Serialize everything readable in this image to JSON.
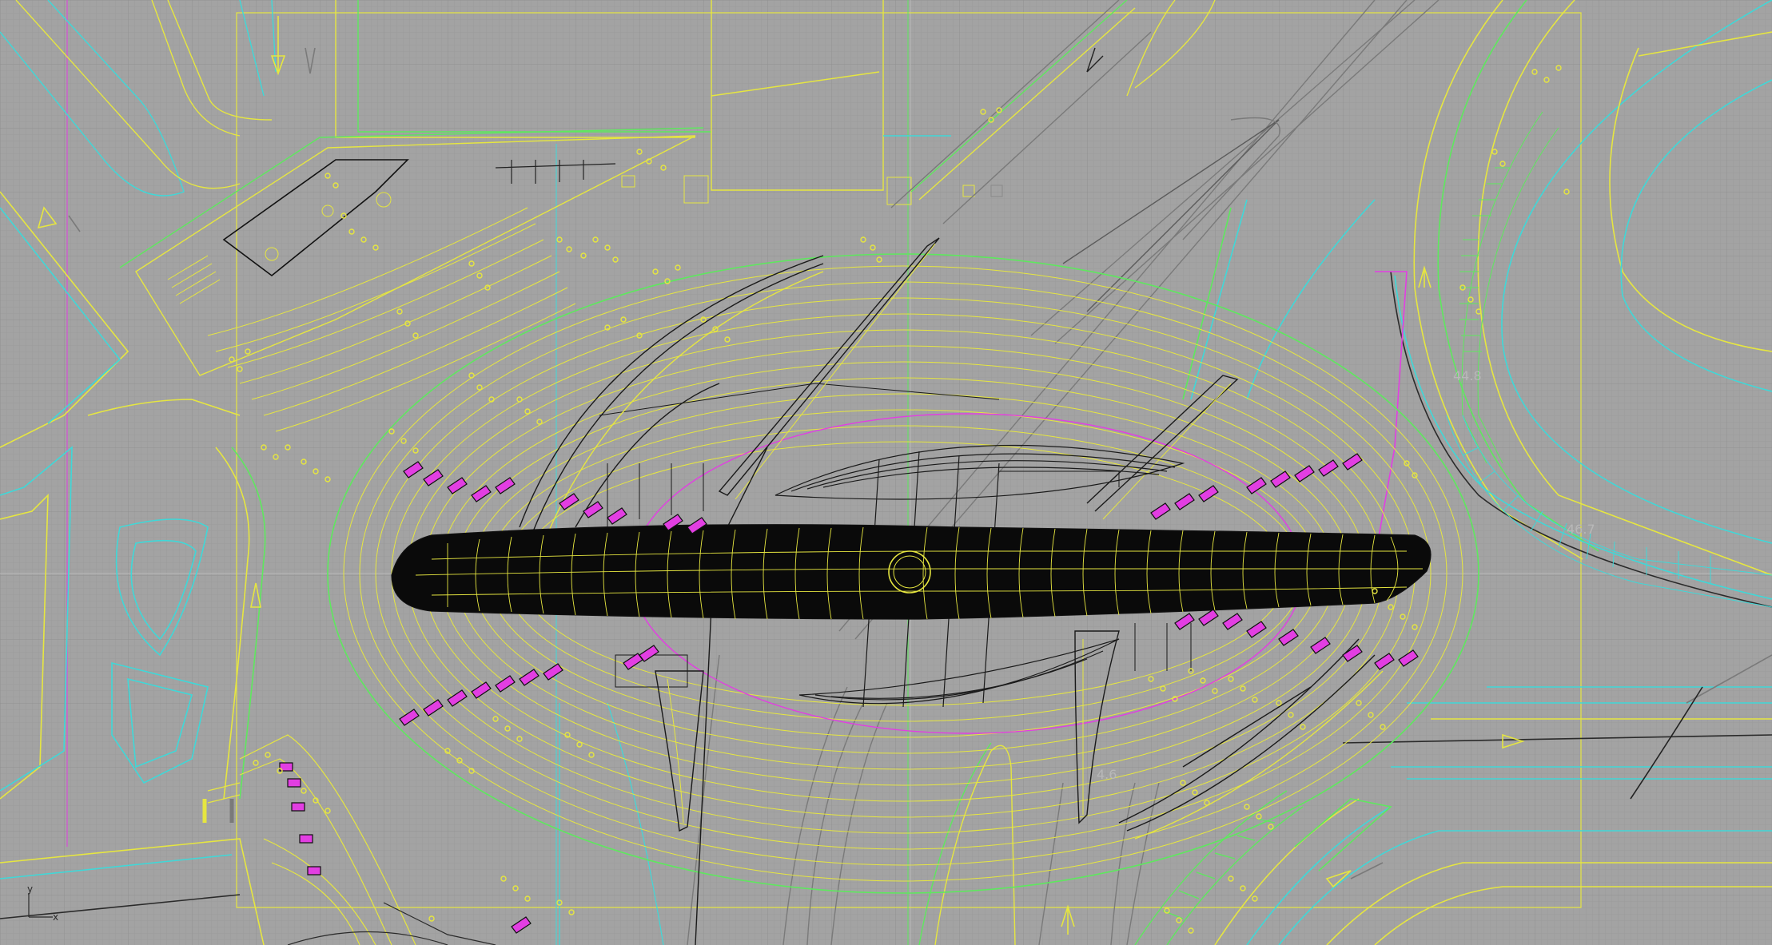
{
  "viewport": {
    "background": "#a3a3a3",
    "grid_minor": "#9a9a9a",
    "grid_major": "#8e8e8e",
    "view_axis": "#b5b5b5"
  },
  "colors": {
    "yellow": "#e6e640",
    "cyan": "#3fd8d8",
    "green": "#5ee85e",
    "magenta": "#e23ee2",
    "black": "#0a0a0a",
    "gray_line": "#7a7a7a"
  },
  "dimension_labels": {
    "left_value": "",
    "ramp_top": "44.8",
    "ramp_lower": "46.7",
    "lower_center": "4.6"
  },
  "axis_icon": {
    "y_label": "y",
    "x_label": "x"
  },
  "icons": [
    "yellow-arrow-icon",
    "axis-triad-icon"
  ]
}
